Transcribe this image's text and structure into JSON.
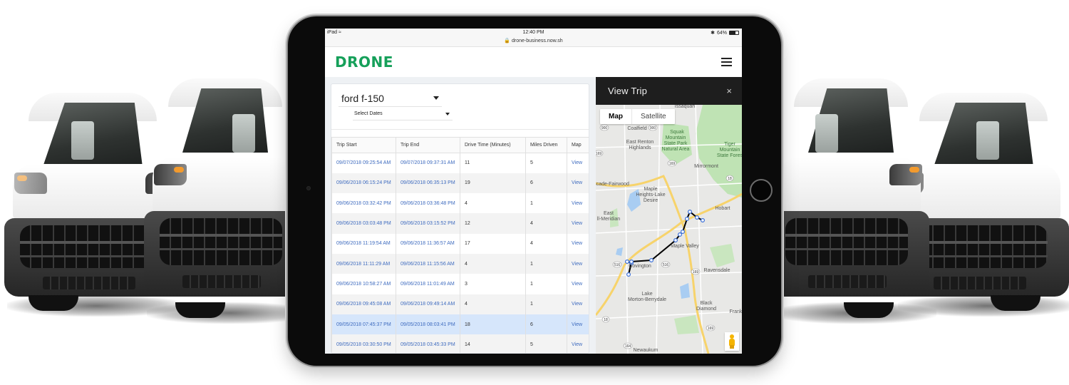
{
  "device": {
    "status_bar": {
      "device_name": "iPad",
      "time": "12:40 PM",
      "url": "drone-business.now.sh",
      "battery_percent": "64%",
      "battery_level": 0.64
    }
  },
  "app": {
    "logo": "DRONE",
    "brand_color": "#16a05a",
    "menu_icon": "hamburger-icon"
  },
  "filters": {
    "vehicle": "ford f-150",
    "dates_placeholder": "Select Dates"
  },
  "table": {
    "columns": [
      "Trip Start",
      "Trip End",
      "Drive Time (Minutes)",
      "Miles Driven",
      "Map"
    ],
    "rows": [
      {
        "start": "09/07/2018 09:25:54 AM",
        "end": "09/07/2018 09:37:31 AM",
        "drive_time": "11",
        "miles": "5",
        "map": "View",
        "selected": false
      },
      {
        "start": "09/06/2018 06:15:24 PM",
        "end": "09/06/2018 06:35:13 PM",
        "drive_time": "19",
        "miles": "6",
        "map": "View",
        "selected": false
      },
      {
        "start": "09/06/2018 03:32:42 PM",
        "end": "09/06/2018 03:36:48 PM",
        "drive_time": "4",
        "miles": "1",
        "map": "View",
        "selected": false
      },
      {
        "start": "09/06/2018 03:03:48 PM",
        "end": "09/06/2018 03:15:52 PM",
        "drive_time": "12",
        "miles": "4",
        "map": "View",
        "selected": false
      },
      {
        "start": "09/06/2018 11:19:54 AM",
        "end": "09/06/2018 11:36:57 AM",
        "drive_time": "17",
        "miles": "4",
        "map": "View",
        "selected": false
      },
      {
        "start": "09/06/2018 11:11:29 AM",
        "end": "09/06/2018 11:15:56 AM",
        "drive_time": "4",
        "miles": "1",
        "map": "View",
        "selected": false
      },
      {
        "start": "09/06/2018 10:58:27 AM",
        "end": "09/06/2018 11:01:49 AM",
        "drive_time": "3",
        "miles": "1",
        "map": "View",
        "selected": false
      },
      {
        "start": "09/06/2018 09:45:08 AM",
        "end": "09/06/2018 09:49:14 AM",
        "drive_time": "4",
        "miles": "1",
        "map": "View",
        "selected": false
      },
      {
        "start": "09/05/2018 07:45:37 PM",
        "end": "09/05/2018 08:03:41 PM",
        "drive_time": "18",
        "miles": "6",
        "map": "View",
        "selected": true
      },
      {
        "start": "09/05/2018 03:30:50 PM",
        "end": "09/05/2018 03:45:33 PM",
        "drive_time": "14",
        "miles": "5",
        "map": "View",
        "selected": false
      }
    ],
    "link_color": "#3e6bbf",
    "selected_row_color": "#d6e6fb"
  },
  "trip_panel": {
    "title": "View Trip",
    "close_label": "×",
    "map_types": {
      "map": "Map",
      "satellite": "Satellite",
      "active": "Map"
    },
    "place_labels": [
      "Coalfield",
      "East Renton Highlands",
      "Maple Heights-Lake Desire",
      "Mirrormont",
      "Cascade-Fairwood",
      "East Hill-Meridian",
      "Hobart",
      "Maple Valley",
      "Covington",
      "Ravensdale",
      "Lake Morton-Berrydale",
      "Black Diamond",
      "Franklin",
      "Newaukum",
      "Issaquah",
      "Squak Mountain State Park Natural Area",
      "Tiger Mountain State Forest"
    ],
    "highway_shields": [
      "900",
      "900",
      "169",
      "169",
      "18",
      "516",
      "516",
      "169",
      "18",
      "169",
      "164"
    ],
    "route_color": "#000000",
    "marker_color": "#3a6fd8"
  }
}
